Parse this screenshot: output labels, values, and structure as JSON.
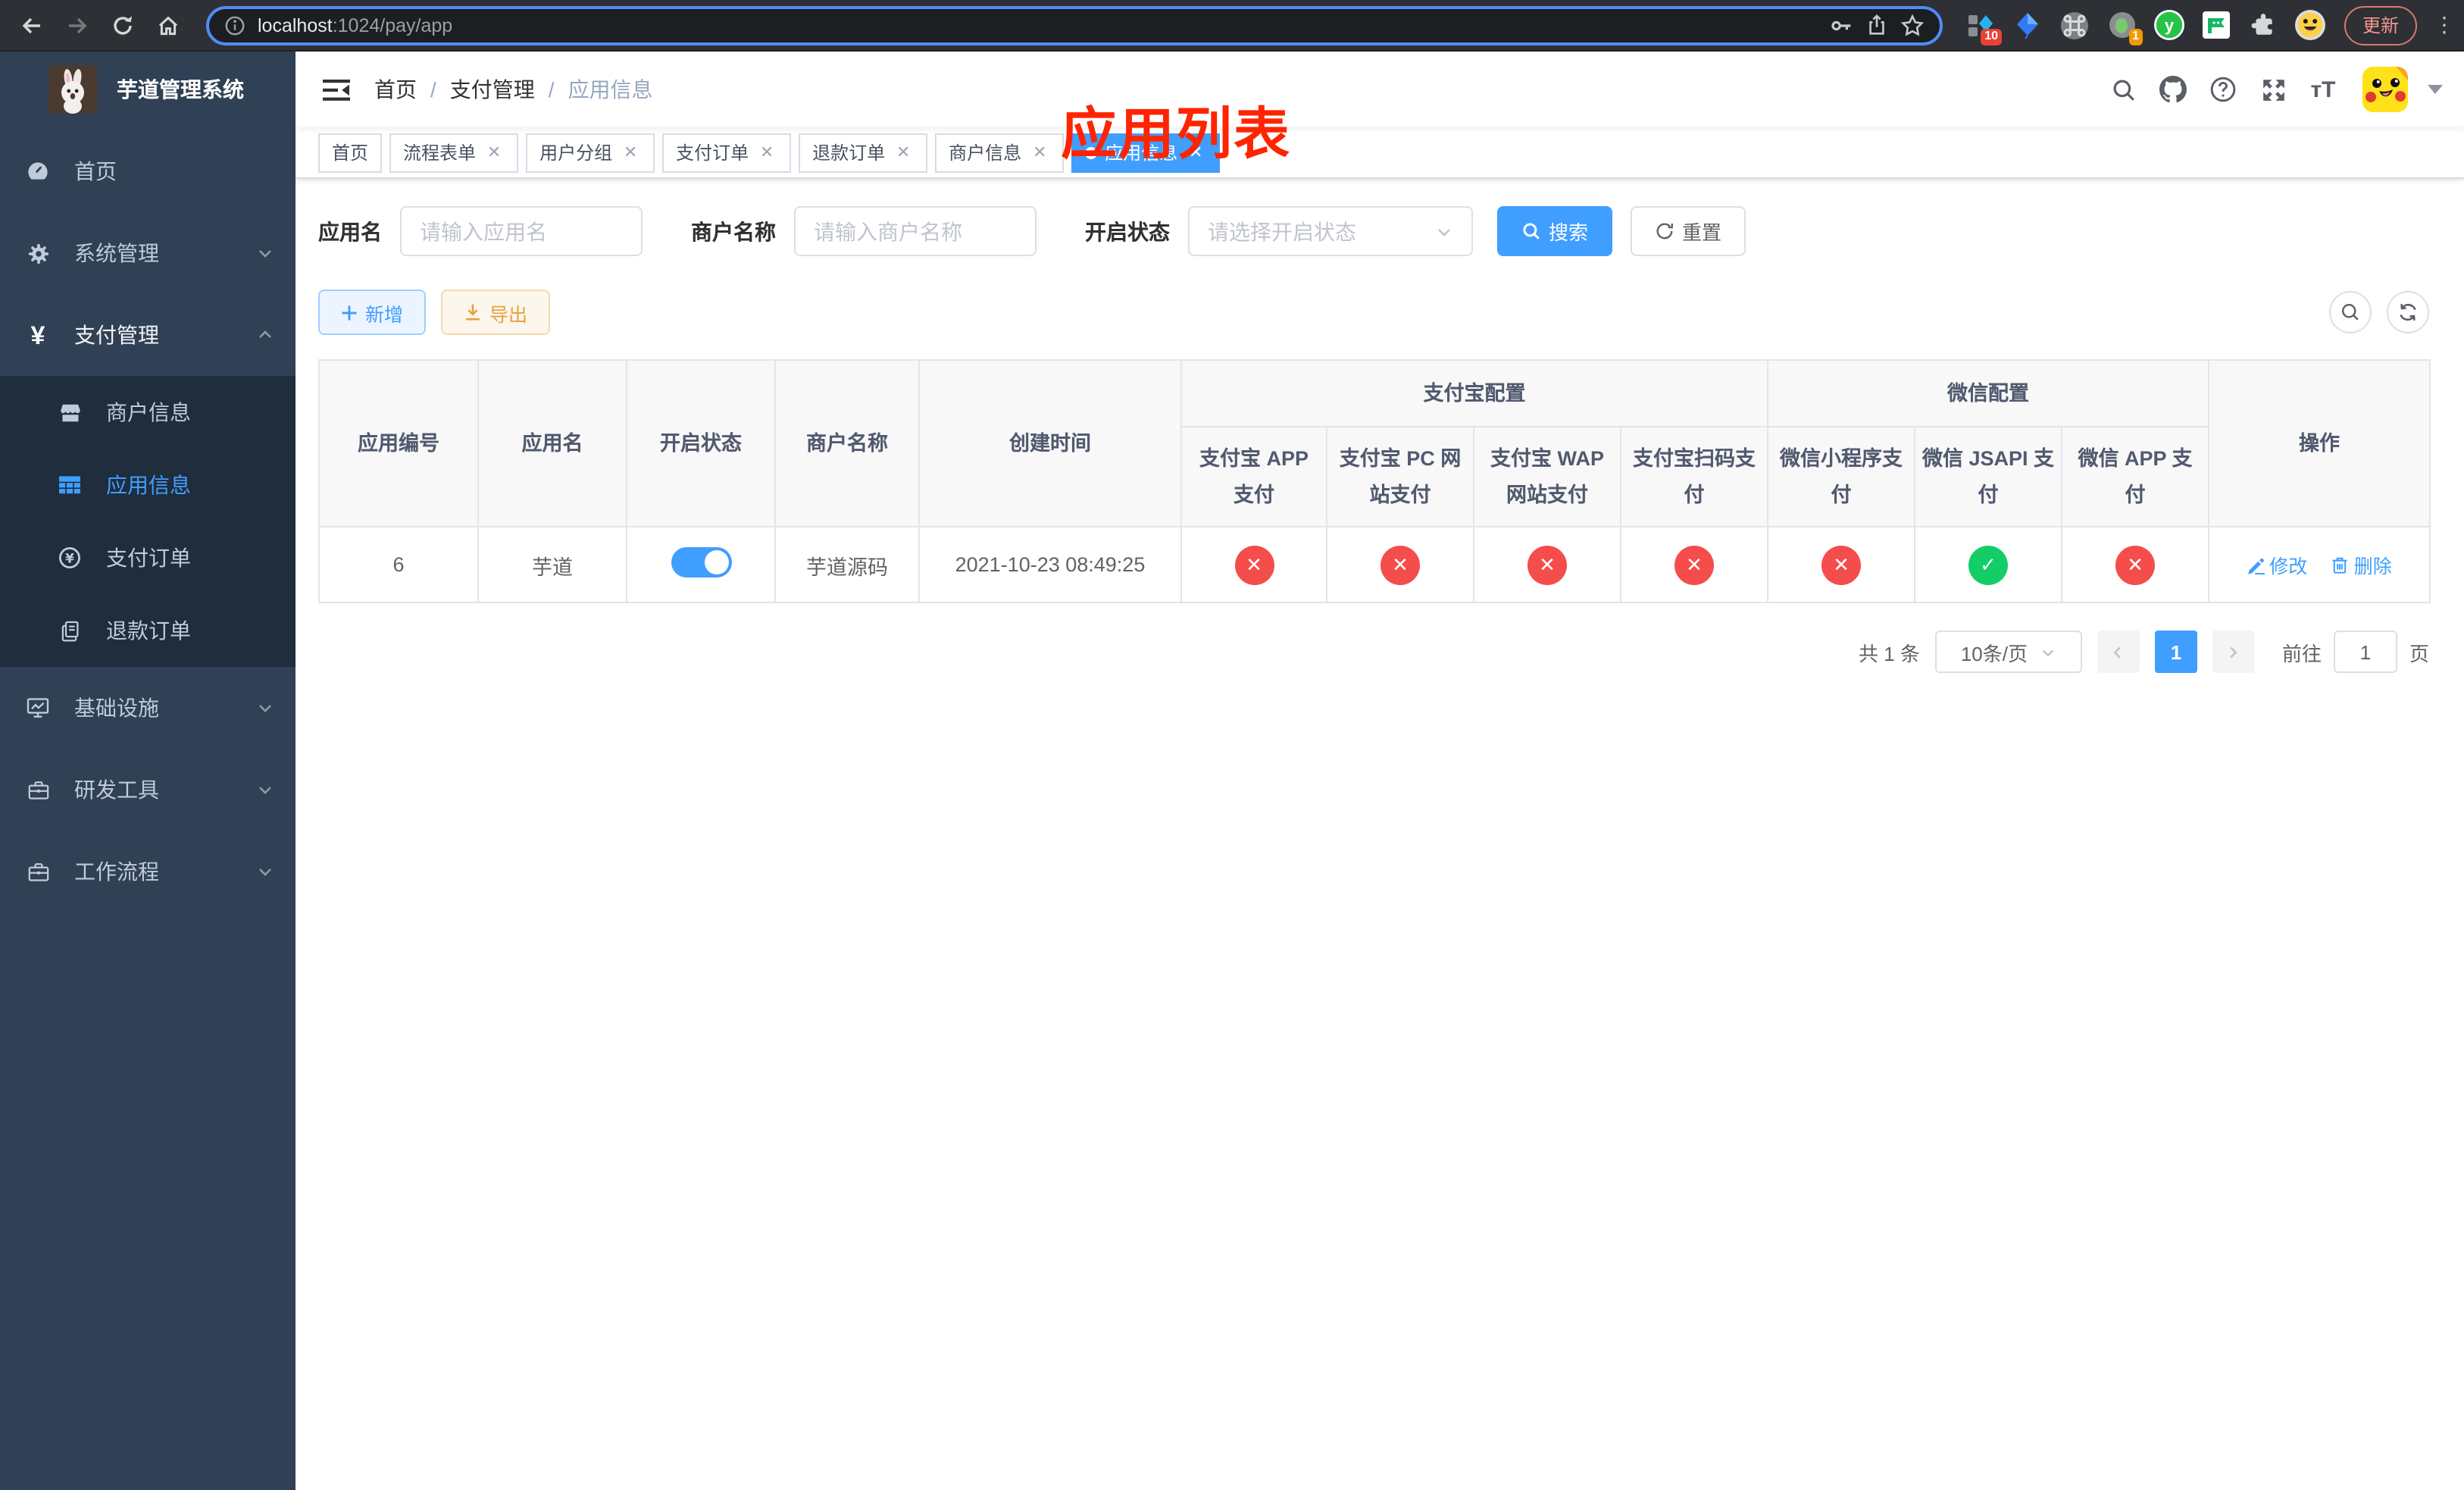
{
  "browser": {
    "url_host": "localhost",
    "url_rest": ":1024/pay/app",
    "ext_badge_tabs": "10",
    "ext_badge_green": "1",
    "update_label": "更新"
  },
  "sidebar": {
    "title": "芋道管理系统",
    "home": "首页",
    "system": "系统管理",
    "payment": "支付管理",
    "merchant": "商户信息",
    "app_info": "应用信息",
    "pay_order": "支付订单",
    "refund_order": "退款订单",
    "infra": "基础设施",
    "dev_tools": "研发工具",
    "workflow": "工作流程"
  },
  "navbar": {
    "breadcrumb_home": "首页",
    "breadcrumb_payment": "支付管理",
    "breadcrumb_current": "应用信息"
  },
  "annotation": {
    "text": "应用列表",
    "color": "#ff2400"
  },
  "tags": [
    {
      "label": "首页",
      "closable": false,
      "active": false
    },
    {
      "label": "流程表单",
      "closable": true,
      "active": false
    },
    {
      "label": "用户分组",
      "closable": true,
      "active": false
    },
    {
      "label": "支付订单",
      "closable": true,
      "active": false
    },
    {
      "label": "退款订单",
      "closable": true,
      "active": false
    },
    {
      "label": "商户信息",
      "closable": true,
      "active": false
    },
    {
      "label": "应用信息",
      "closable": true,
      "active": true
    }
  ],
  "filters": {
    "app_name_label": "应用名",
    "app_name_placeholder": "请输入应用名",
    "merchant_label": "商户名称",
    "merchant_placeholder": "请输入商户名称",
    "status_label": "开启状态",
    "status_placeholder": "请选择开启状态",
    "search_label": "搜索",
    "reset_label": "重置"
  },
  "toolbar": {
    "add_label": "新增",
    "export_label": "导出"
  },
  "table": {
    "headers": {
      "app_id": "应用编号",
      "app_name": "应用名",
      "status": "开启状态",
      "merchant_name": "商户名称",
      "create_time": "创建时间",
      "alipay_group": "支付宝配置",
      "wechat_group": "微信配置",
      "alipay_app": "支付宝 APP 支付",
      "alipay_pc": "支付宝 PC 网站支付",
      "alipay_wap": "支付宝 WAP 网站支付",
      "alipay_qr": "支付宝扫码支付",
      "wechat_lite": "微信小程序支付",
      "wechat_jsapi": "微信 JSAPI 支付",
      "wechat_app": "微信 APP 支付",
      "actions": "操作"
    },
    "rows": [
      {
        "app_id": "6",
        "app_name": "芋道",
        "enabled": true,
        "merchant_name": "芋道源码",
        "create_time": "2021-10-23 08:49:25",
        "pay_channels": [
          "no",
          "no",
          "no",
          "no",
          "no",
          "yes",
          "no"
        ],
        "edit_label": "修改",
        "delete_label": "删除"
      }
    ]
  },
  "pagination": {
    "total": "共 1 条",
    "page_size": "10条/页",
    "current_page": "1",
    "goto_label": "前往",
    "goto_value": "1",
    "goto_suffix": "页"
  },
  "colors": {
    "accent": "#409eff",
    "success": "#13ce66",
    "danger": "#f54c4c",
    "sidebar": "#304156",
    "submenu": "#1f2d3d"
  }
}
